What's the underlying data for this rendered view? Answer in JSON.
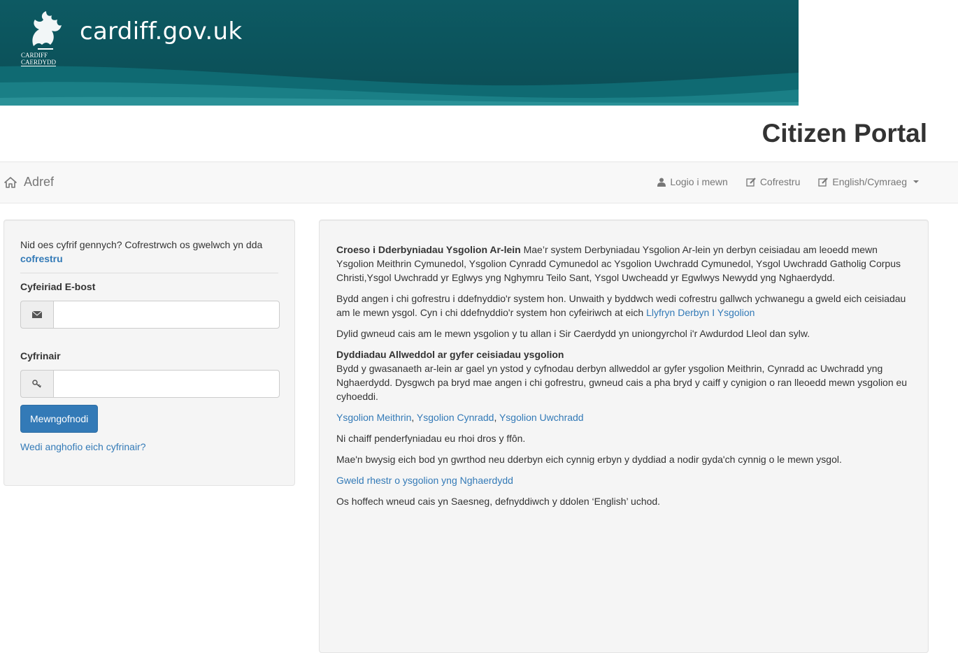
{
  "banner": {
    "site_name": "cardiff.gov.uk",
    "logo_line1": "CARDIFF",
    "logo_line2": "CAERDYDD",
    "colors": {
      "background": "#0b4d55",
      "wave": "#1a7f86"
    }
  },
  "page_title": "Citizen Portal",
  "navbar": {
    "home_label": "Adref",
    "home_icon": "home-icon",
    "items": [
      {
        "label": "Logio i mewn",
        "icon": "user-icon"
      },
      {
        "label": "Cofrestru",
        "icon": "edit-icon"
      },
      {
        "label": "English/Cymraeg",
        "icon": "edit-icon"
      }
    ]
  },
  "login": {
    "intro_text": "Nid oes cyfrif gennych? Cofrestrwch os gwelwch yn dda",
    "intro_link": "cofrestru",
    "email_label": "Cyfeiriad E-bost",
    "email_value": "",
    "email_icon": "envelope-icon",
    "password_label": "Cyfrinair",
    "password_value": "",
    "password_icon": "key-icon",
    "submit_label": "Mewngofnodi",
    "forgot_link": "Wedi anghofio eich cyfrinair?"
  },
  "info": {
    "p1_bold": "Croeso i Dderbyniadau Ysgolion Ar-lein",
    "p1_text": " Mae’r system Derbyniadau Ysgolion Ar-lein yn derbyn ceisiadau am leoedd mewn Ysgolion Meithrin Cymunedol, Ysgolion Cynradd Cymunedol ac Ysgolion Uwchradd Cymunedol, Ysgol Uwchradd Gatholig Corpus Christi,Ysgol Uwchradd yr Eglwys yng Nghymru Teilo Sant, Ysgol Uwcheadd yr Egwlwys Newydd yng Nghaerdydd.",
    "p2_text": "Bydd angen i chi gofrestru i ddefnyddio'r system hon. Unwaith y byddwch wedi cofrestru gallwch ychwanegu a gweld eich ceisiadau am le mewn ysgol. Cyn i chi ddefnyddio'r system hon cyfeiriwch at eich ",
    "p2_link": "Llyfryn Derbyn I Ysgolion",
    "p3_text": "Dylid gwneud cais am le mewn ysgolion y tu allan i Sir Caerdydd yn uniongyrchol i'r Awdurdod Lleol dan sylw.",
    "p4_heading": "Dyddiadau Allweddol ar gyfer ceisiadau ysgolion",
    "p4_text": "Bydd y gwasanaeth ar-lein ar gael yn ystod y cyfnodau derbyn allweddol ar gyfer ysgolion Meithrin, Cynradd ac Uwchradd yng Nghaerdydd. Dysgwch pa bryd mae angen i chi gofrestru, gwneud cais a pha bryd y caiff y cynigion o ran lleoedd mewn ysgolion eu cyhoeddi.",
    "links_row": [
      "Ysgolion Meithrin",
      "Ysgolion Cynradd",
      "Ysgolion Uwchradd"
    ],
    "links_sep": ", ",
    "p6_text": "Ni chaiff penderfyniadau eu rhoi dros y ffôn.",
    "p7_text": "Mae'n bwysig eich bod yn gwrthod neu dderbyn eich cynnig erbyn y dyddiad a nodir gyda'ch cynnig o le mewn ysgol.",
    "p8_link": "Gweld rhestr o ysgolion yng Nghaerdydd",
    "p9_text": "Os hoffech wneud cais yn Saesneg, defnyddiwch y ddolen ‘English’ uchod."
  }
}
